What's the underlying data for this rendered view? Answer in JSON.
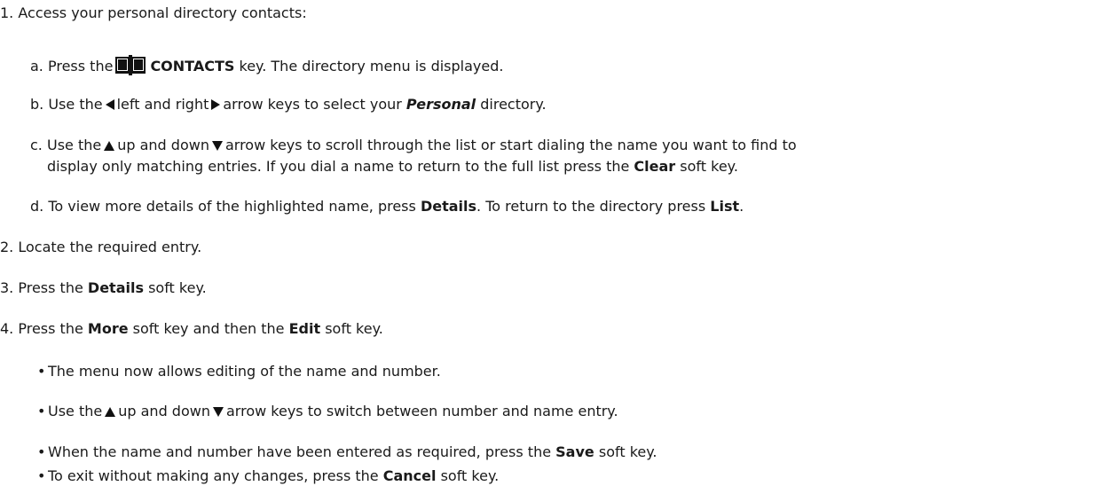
{
  "steps": {
    "s1": "1. Access your personal directory contacts:",
    "a": {
      "num": "a.",
      "t1": "Press the",
      "key": "CONTACTS",
      "t2": "key. The directory menu is displayed."
    },
    "b": {
      "num": "b.",
      "t1": "Use the",
      "t2": "left and right",
      "t3": "arrow keys to select your",
      "em": "Personal",
      "t4": "directory."
    },
    "c": {
      "num": "c.",
      "t1": "Use the",
      "t2": "up and down",
      "t3": "arrow keys to scroll through the list or start dialing the name you want to find to",
      "line2a": "display only matching entries. If you dial a name to return to the full list press the",
      "key": "Clear",
      "line2b": "soft key."
    },
    "d": {
      "num": "d.",
      "t1": "To view more details of the highlighted name, press",
      "key1": "Details",
      "t2": ". To return to the directory press",
      "key2": "List",
      "t3": "."
    },
    "s2": "2. Locate the required entry.",
    "s3": {
      "t1": "3. Press the",
      "key": "Details",
      "t2": "soft key."
    },
    "s4": {
      "t1": "4. Press the",
      "key1": "More",
      "t2": "soft key and then the",
      "key2": "Edit",
      "t3": "soft key."
    },
    "bullets": {
      "b1": "The menu now allows editing of the name and number.",
      "b2": {
        "t1": "Use the",
        "t2": "up and down",
        "t3": "arrow keys to switch between number and name entry."
      },
      "b3": {
        "t1": "When the name and number have been entered as required, press the",
        "key": "Save",
        "t2": "soft key."
      },
      "b4": {
        "t1": "To exit without making any changes, press the",
        "key": "Cancel",
        "t2": "soft key."
      }
    }
  }
}
